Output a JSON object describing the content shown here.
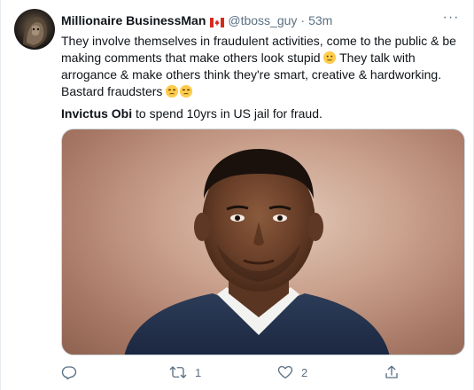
{
  "tweet": {
    "author_name": "Millionaire BusinessMan",
    "author_flag": "canada-flag",
    "handle": "@tboss_guy",
    "separator": "·",
    "time": "53m",
    "more_label": "···",
    "text_part1": "They involve themselves in fraudulent activities, come to the public & be making comments that make others look stupid ",
    "text_part2": " They talk with arrogance & make others think they're smart, creative & hardworking. Bastard fraudsters ",
    "emoji_1": "neutral-face",
    "emoji_2": "unamused-face",
    "headline_bold": "Invictus Obi",
    "headline_rest": " to spend 10yrs in US jail for fraud.",
    "image_subject": "portrait-photo"
  },
  "actions": {
    "reply_icon": "reply-icon",
    "reply_count": "",
    "retweet_icon": "retweet-icon",
    "retweet_count": "1",
    "like_icon": "heart-icon",
    "like_count": "2",
    "share_icon": "share-icon"
  },
  "colors": {
    "text_primary": "#0f1419",
    "text_secondary": "#5b7083",
    "border": "#cfd9de"
  }
}
